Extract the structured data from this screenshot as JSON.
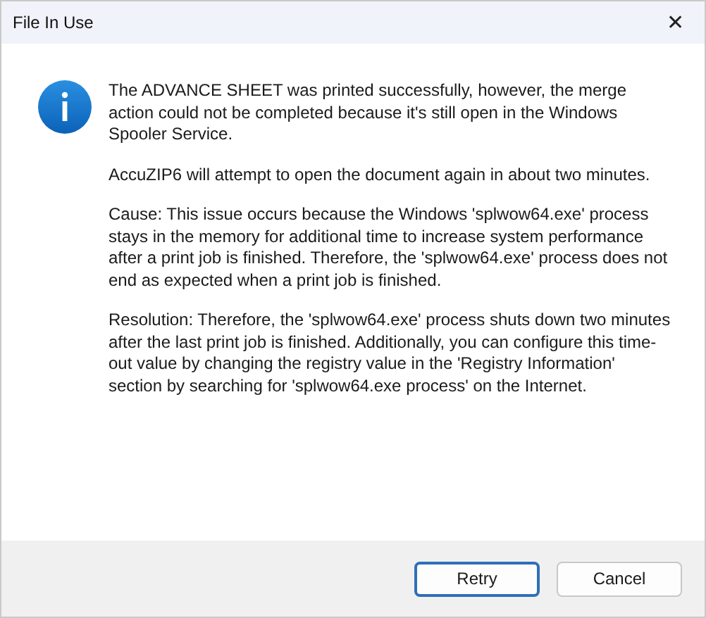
{
  "window": {
    "title": "File In Use",
    "close": "✕"
  },
  "message": {
    "paragraphs": [
      "The ADVANCE SHEET was printed successfully, however, the merge action could not be completed because it's still open in the Windows Spooler Service.",
      "AccuZIP6 will attempt to open the document again in about two minutes.",
      "Cause: This issue occurs because the Windows 'splwow64.exe' process stays in the memory for additional time to increase system performance after a print job is finished. Therefore, the 'splwow64.exe' process does not end as expected when a print job is finished.",
      "Resolution: Therefore, the 'splwow64.exe' process shuts down two minutes after the last print job is finished. Additionally, you can configure this time-out value by changing the registry value in the 'Registry Information' section by searching for 'splwow64.exe process' on the Internet."
    ]
  },
  "buttons": [
    {
      "label": "Retry",
      "default": true
    },
    {
      "label": "Cancel",
      "default": false
    }
  ]
}
